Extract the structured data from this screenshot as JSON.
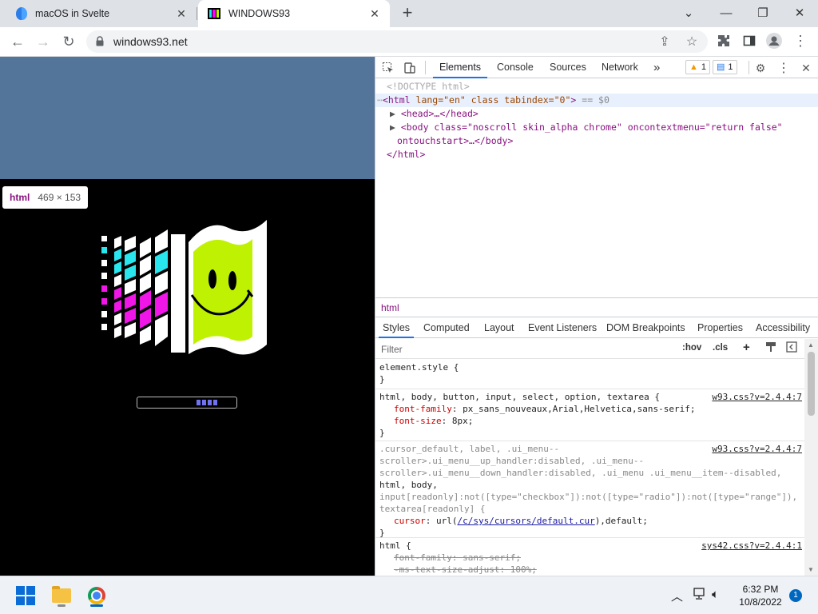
{
  "browser": {
    "tabs": [
      {
        "title": "macOS in Svelte",
        "active": false
      },
      {
        "title": "WINDOWS93",
        "active": true
      }
    ],
    "url": "windows93.net"
  },
  "page": {
    "inspect_tooltip": {
      "tag": "html",
      "dims": "469 × 153"
    },
    "loading_progress": 0.35
  },
  "devtools": {
    "tabs": [
      "Elements",
      "Console",
      "Sources",
      "Network"
    ],
    "active_tab": "Elements",
    "more_tabs": "»",
    "warnings_count": "1",
    "messages_count": "1",
    "dom": {
      "doctype": "<!DOCTYPE html>",
      "html_open": {
        "tag": "html",
        "attrs": "lang=\"en\" class tabindex=\"0\"",
        "suffix": "== $0"
      },
      "head": "<head>…</head>",
      "body_open": "<body class=\"noscroll skin_alpha chrome\" oncontextmenu=\"return false\"",
      "body_close": "ontouchstart>…</body>",
      "html_close": "</html>"
    },
    "breadcrumb": "html",
    "subtabs": [
      "Styles",
      "Computed",
      "Layout",
      "Event Listeners",
      "DOM Breakpoints",
      "Properties",
      "Accessibility"
    ],
    "active_subtab": "Styles",
    "filter_placeholder": "Filter",
    "hov": ":hov",
    "cls": ".cls",
    "rules": [
      {
        "selector": "element.style {",
        "source": "",
        "props": [],
        "close": "}"
      },
      {
        "selector": "html, body, button, input, select, option, textarea {",
        "source": "w93.css?v=2.4.4:7",
        "props": [
          {
            "name": "font-family",
            "value": "px_sans_nouveaux,Arial,Helvetica,sans-serif;"
          },
          {
            "name": "font-size",
            "value": "8px;"
          }
        ],
        "close": "}"
      },
      {
        "selector_lines": [
          ".cursor_default, label, .ui_menu--",
          "scroller>.ui_menu__up_handler:disabled, .ui_menu--",
          "scroller>.ui_menu__down_handler:disabled, .ui_menu .ui_menu__item--disabled,",
          "html, body,",
          "input[readonly]:not([type=\"checkbox\"]):not([type=\"radio\"]):not([type=\"range\"]),",
          "textarea[readonly] {"
        ],
        "source": "w93.css?v=2.4.4:7",
        "props": [
          {
            "name": "cursor",
            "link": "/c/sys/cursors/default.cur",
            "after": "),default;"
          }
        ],
        "close": "}"
      },
      {
        "selector": "html {",
        "source": "sys42.css?v=2.4.4:1",
        "props": [
          {
            "name": "font-family",
            "value": "sans-serif;"
          },
          {
            "name": "-ms-text-size-adjust",
            "value": "100%;"
          }
        ]
      }
    ]
  },
  "taskbar": {
    "time": "6:32 PM",
    "date": "10/8/2022",
    "notifications": "1"
  }
}
